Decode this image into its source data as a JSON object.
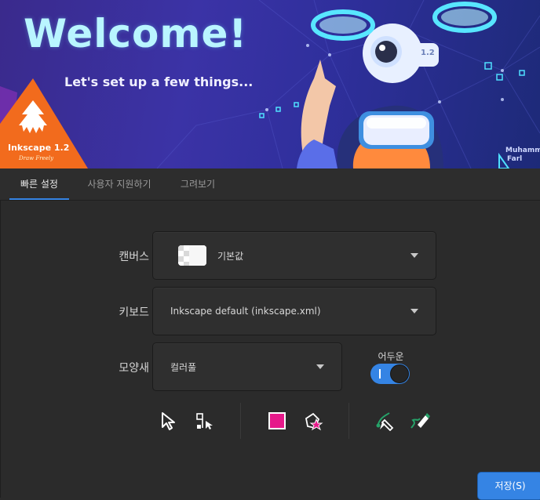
{
  "banner": {
    "title": "Welcome!",
    "subtitle": "Let's set up a few things...",
    "logo_name": "Inkscape 1.2",
    "logo_tagline": "Draw Freely",
    "drone_version": "1.2",
    "credit_line1": "Muhamm",
    "credit_line2": "Farl"
  },
  "tabs": [
    {
      "label": "빠른 설정",
      "active": true
    },
    {
      "label": "사용자 지원하기",
      "active": false
    },
    {
      "label": "그려보기",
      "active": false
    }
  ],
  "form": {
    "canvas": {
      "label": "캔버스",
      "value": "기본값"
    },
    "keyboard": {
      "label": "키보드",
      "value": "Inkscape default (inkscape.xml)"
    },
    "theme": {
      "label": "모양새",
      "value": "컬러풀"
    },
    "dark": {
      "label": "어두운",
      "enabled": true
    }
  },
  "tools": [
    {
      "name": "selector-tool-icon"
    },
    {
      "name": "node-tool-icon"
    },
    {
      "name": "rect-fill-icon"
    },
    {
      "name": "star-object-icon"
    },
    {
      "name": "bezier-pen-icon"
    },
    {
      "name": "calligraphy-pen-icon"
    }
  ],
  "save_label": "저장(S)",
  "colors": {
    "accent": "#3584e4",
    "banner_bg": "#3b33a6",
    "title": "#b9f5ff",
    "logo_orange": "#f26b1d",
    "swatch_pink": "#e6198a",
    "pen_green": "#26a269"
  }
}
